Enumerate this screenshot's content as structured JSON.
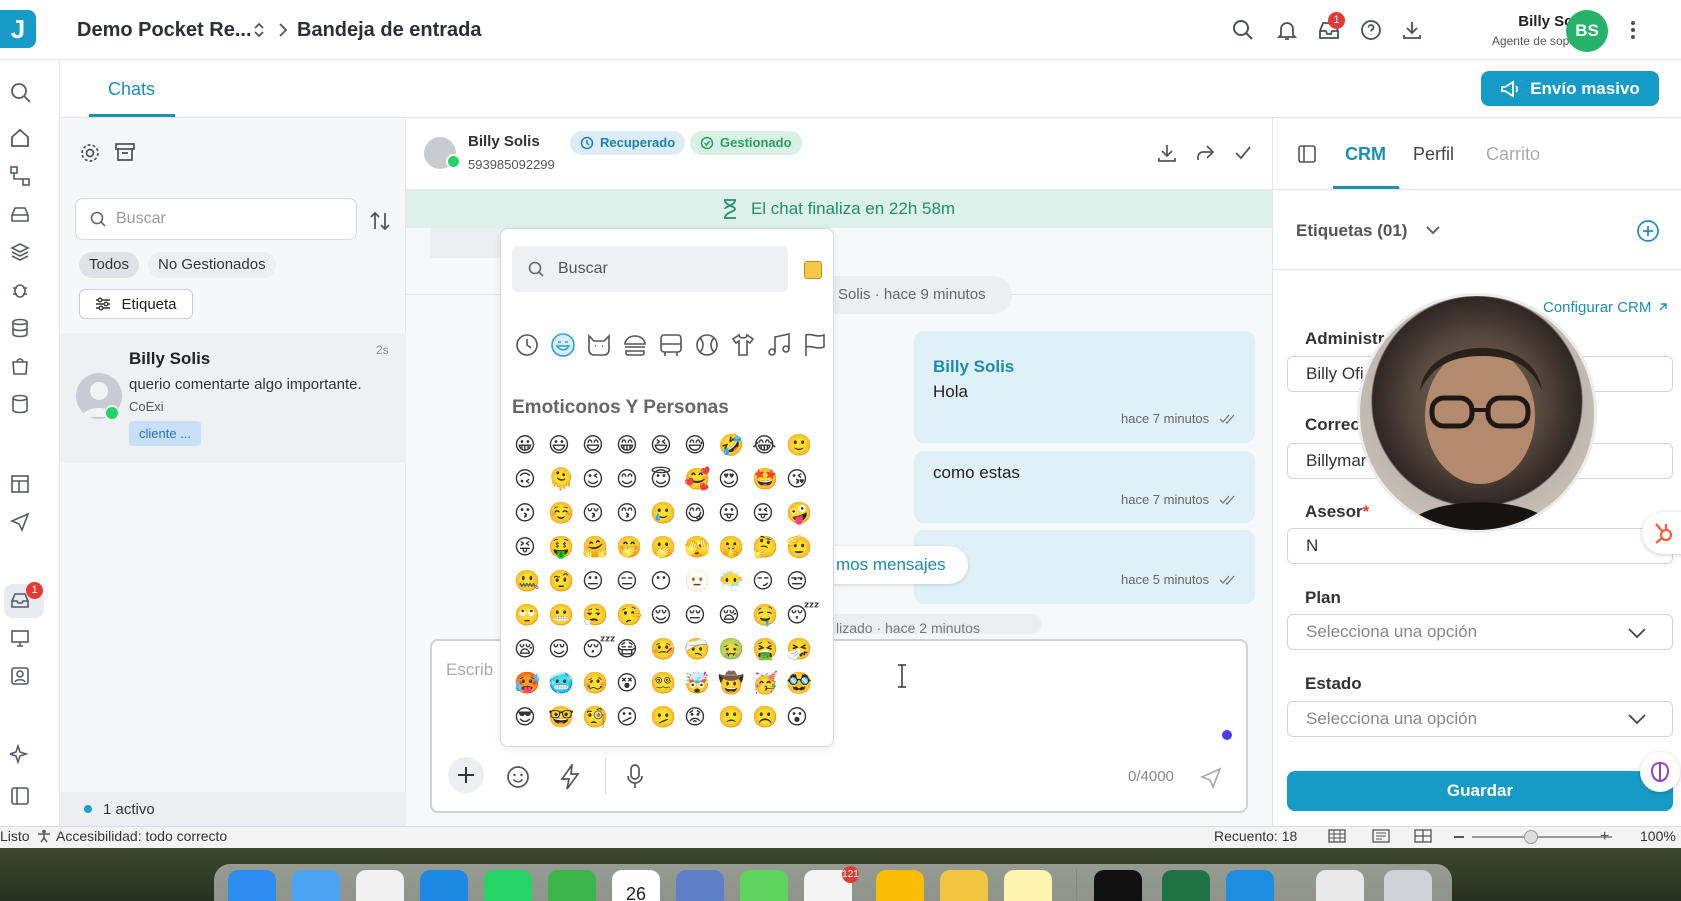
{
  "header": {
    "logo_letter": "J",
    "workspace": "Demo Pocket Re...",
    "inbox_title": "Bandeja de entrada",
    "inbox_badge": "1",
    "user_name": "Billy Solis",
    "user_role": "Agente de soporte",
    "user_initials": "BS"
  },
  "rail": {
    "inbox_badge": "1"
  },
  "subheader": {
    "tab_chats": "Chats",
    "mass_send": "Envío masivo"
  },
  "chat_list": {
    "search_placeholder": "Buscar",
    "filter_all": "Todos",
    "filter_unmanaged": "No Gestionados",
    "tag_button": "Etiqueta",
    "conversations": [
      {
        "name": "Billy Solis",
        "message": "querio comentarte algo importante.",
        "subtitle": "CoExi",
        "time": "2s",
        "tag": "cliente ..."
      }
    ],
    "active_text": "1 activo"
  },
  "chat": {
    "contact_name": "Billy Solis",
    "contact_phone": "593985092299",
    "badge_recovered": "Recuperado",
    "badge_managed": "Gestionado",
    "timer_text": "El chat finaliza en 22h 58m",
    "system_pill": "Solis  ·  hace 9 minutos",
    "messages": [
      {
        "sender": "Billy Solis",
        "text": "Hola",
        "time": "hace 7 minutos"
      },
      {
        "text": "como estas",
        "time": "hace 7 minutos"
      },
      {
        "text": "",
        "time": "hace 5 minutos"
      }
    ],
    "new_messages": "mos mensajes",
    "partial_system": "lizado  ·  hace 2 minutos",
    "composer_placeholder": "Escrib",
    "char_count": "0/4000"
  },
  "emoji_picker": {
    "search_placeholder": "Buscar",
    "section_title": "Emoticonos Y Personas",
    "emojis": [
      "😀",
      "😃",
      "😄",
      "😁",
      "😆",
      "😅",
      "🤣",
      "😂",
      "🙂",
      "🙃",
      "🫠",
      "😉",
      "😊",
      "😇",
      "🥰",
      "😍",
      "🤩",
      "😘",
      "😗",
      "☺️",
      "😚",
      "😙",
      "🥲",
      "😋",
      "😛",
      "😜",
      "🤪",
      "😝",
      "🤑",
      "🤗",
      "🤭",
      "🫢",
      "🫣",
      "🤫",
      "🤔",
      "🫡",
      "🤐",
      "🤨",
      "😐",
      "😑",
      "😶",
      "🫥",
      "😶‍🌫️",
      "😏",
      "😒",
      "🙄",
      "😬",
      "😮‍💨",
      "🤥",
      "😌",
      "😔",
      "😪",
      "🤤",
      "😴",
      "😪",
      "😌",
      "😴",
      "😷",
      "🤒",
      "🤕",
      "🤢",
      "🤮",
      "🤧",
      "🥵",
      "🥶",
      "🥴",
      "😵",
      "😵‍💫",
      "🤯",
      "🤠",
      "🥳",
      "🥸",
      "😎",
      "🤓",
      "🧐",
      "😕",
      "🫤",
      "😟",
      "🙁",
      "☹️",
      "😮"
    ]
  },
  "crm": {
    "tab_crm": "CRM",
    "tab_profile": "Perfil",
    "tab_cart": "Carrito",
    "tags_label": "Etiquetas (01)",
    "configure": "Configurar CRM",
    "fields": [
      {
        "label": "Administr",
        "value": "Billy Ofi"
      },
      {
        "label": "Correo",
        "value": "Billymar"
      },
      {
        "label": "Asesor",
        "required": "*",
        "value": "N"
      },
      {
        "label": "Plan",
        "value": "Selecciona una opción"
      },
      {
        "label": "Estado",
        "value": "Selecciona una opción"
      }
    ],
    "save": "Guardar"
  },
  "statusbar": {
    "ready": "Listo",
    "accessibility": "Accesibilidad: todo correcto",
    "count": "Recuento: 18",
    "zoom": "100%"
  },
  "dock": {
    "calendar_day": "26",
    "slack_badge": "121"
  },
  "colors": {
    "accent": "#159bc5",
    "green": "#24b368",
    "badge": "#e53935"
  }
}
